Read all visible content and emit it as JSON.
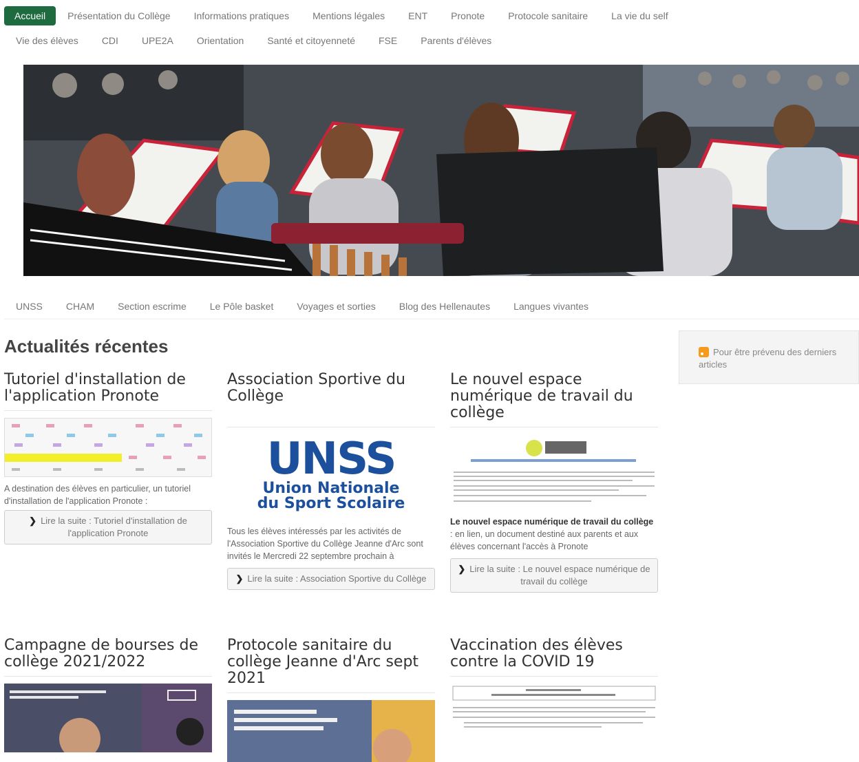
{
  "topnav": {
    "row1": [
      "Accueil",
      "Présentation du Collège",
      "Informations pratiques",
      "Mentions légales",
      "ENT",
      "Pronote",
      "Protocole sanitaire",
      "La vie du self"
    ],
    "row2": [
      "Vie des élèves",
      "CDI",
      "UPE2A",
      "Orientation",
      "Santé et citoyenneté",
      "FSE",
      "Parents d'élèves"
    ]
  },
  "subnav": [
    "UNSS",
    "CHAM",
    "Section escrime",
    "Le Pôle basket",
    "Voyages et sorties",
    "Blog des Hellenautes",
    "Langues vivantes"
  ],
  "section_title": "Actualités récentes",
  "sidebar": {
    "rss_text": "Pour être prévenu des derniers articles"
  },
  "articles": [
    {
      "title": "Tutoriel d'installation de l'application Pronote",
      "summary": "A destination des élèves en particulier, un tutoriel d'installation de l'application Pronote :",
      "more": "Lire la suite : Tutoriel d'installation de l'application Pronote"
    },
    {
      "title": "Association Sportive du Collège",
      "thumb_line1": "UNSS",
      "thumb_line2": "Union Nationale",
      "thumb_line3": "du Sport Scolaire",
      "summary": "Tous les élèves intéressés par les activités de l'Association Sportive du Collège Jeanne d'Arc sont invités le Mercredi 22 septembre prochain à",
      "more": "Lire la suite : Association Sportive du Collège"
    },
    {
      "title": "Le nouvel espace numérique de travail du collège",
      "summary_bold": "Le nouvel espace numérique de travail du collège",
      "summary": " : en lien, un document destiné aux parents et aux élèves concernant l'accès à Pronote",
      "more": "Lire la suite : Le nouvel espace numérique de travail du collège"
    },
    {
      "title": "Campagne de bourses de collège 2021/2022"
    },
    {
      "title": "Protocole sanitaire du collège Jeanne d'Arc sept 2021"
    },
    {
      "title": "Vaccination des élèves contre la COVID 19"
    }
  ],
  "colors": {
    "accent": "#1d6b3e",
    "unss_blue": "#1c4f9c",
    "unss_red": "#e3342f"
  }
}
